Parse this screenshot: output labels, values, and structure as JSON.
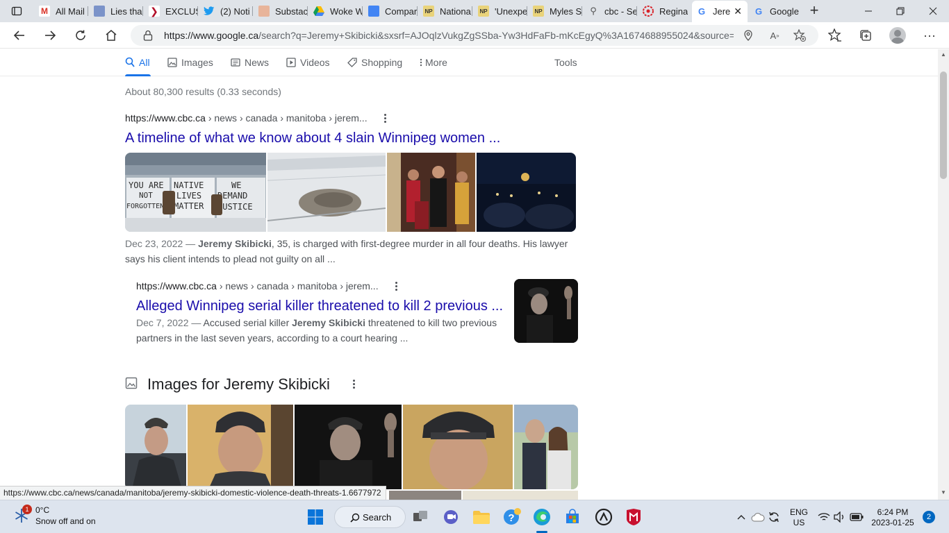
{
  "browser": {
    "tabs": [
      {
        "label": "",
        "icon": "tab-actions-icon"
      },
      {
        "label": "All Mail",
        "icon": "gmail-icon"
      },
      {
        "label": "Lies tha",
        "icon": "docs-icon"
      },
      {
        "label": "EXCLUS",
        "icon": "rumble-icon"
      },
      {
        "label": "(2) Noti",
        "icon": "twitter-icon"
      },
      {
        "label": "Substac",
        "icon": "substack-icon"
      },
      {
        "label": "Woke W",
        "icon": "drive-icon"
      },
      {
        "label": "Compar",
        "icon": "docs-icon"
      },
      {
        "label": "Nationa",
        "icon": "np-icon"
      },
      {
        "label": "'Unexpe",
        "icon": "np-icon"
      },
      {
        "label": "Myles S",
        "icon": "np-icon"
      },
      {
        "label": "cbc - Se",
        "icon": "search-icon"
      },
      {
        "label": "Regina",
        "icon": "cbc-icon"
      },
      {
        "label": "Jere",
        "icon": "google-icon"
      },
      {
        "label": "Google",
        "icon": "google-icon"
      }
    ],
    "url_host": "https://www.google.ca",
    "url_rest": "/search?q=Jeremy+Skibicki&sxsrf=AJOqlzVukgZgSSba-Yw3HdFaFb-mKcEgyQ%3A1674688955024&source=..."
  },
  "search_tabs": [
    {
      "label": "All",
      "icon": "search-icon"
    },
    {
      "label": "Images",
      "icon": "image-icon"
    },
    {
      "label": "News",
      "icon": "news-icon"
    },
    {
      "label": "Videos",
      "icon": "video-icon"
    },
    {
      "label": "Shopping",
      "icon": "tag-icon"
    },
    {
      "label": "More",
      "icon": "more-vert-icon"
    },
    {
      "label": "Tools",
      "icon": ""
    }
  ],
  "result_stats": "About 80,300 results (0.33 seconds)",
  "results": [
    {
      "cite_host": "https://www.cbc.ca",
      "cite_path": " › news › canada › manitoba › jerem...",
      "title": "A timeline of what we know about 4 slain Winnipeg women ...",
      "date": "Dec 23, 2022 — ",
      "snippet_bold": "Jeremy Skibicki",
      "snippet_line1_after": ", 35, is charged with first-degree murder in all four deaths. His lawyer",
      "snippet_line2": "says his client intends to plead not guilty on all ...",
      "sign_words": [
        "YOU ARE",
        "NOT",
        "FORGOTTEN",
        "NATIVE",
        "LIVES",
        "MATTER",
        "WE",
        "DEMAND",
        "JUSTICE"
      ]
    },
    {
      "cite_host": "https://www.cbc.ca",
      "cite_path": " › news › canada › manitoba › jerem...",
      "title": "Alleged Winnipeg serial killer threatened to kill 2 previous ...",
      "date": "Dec 7, 2022 — ",
      "snippet_before": "Accused serial killer ",
      "snippet_bold": "Jeremy Skibicki",
      "snippet_line1_after": " threatened to kill two previous",
      "snippet_line2": "partners in the last seven years, according to a court hearing ..."
    }
  ],
  "images_section": {
    "title": "Images for Jeremy Skibicki"
  },
  "status_url": "https://www.cbc.ca/news/canada/manitoba/jeremy-skibicki-domestic-violence-death-threats-1.6677972",
  "taskbar": {
    "weather_temp": "0°C",
    "weather_desc": "Snow off and on",
    "weather_badge": "1",
    "search_label": "Search",
    "lang_1": "ENG",
    "lang_2": "US",
    "time": "6:24 PM",
    "date": "2023-01-25",
    "notifications": "2"
  },
  "colors": {
    "link": "#1a0dab",
    "accent": "#1a73e8",
    "taskbar": "#dde4ee"
  }
}
